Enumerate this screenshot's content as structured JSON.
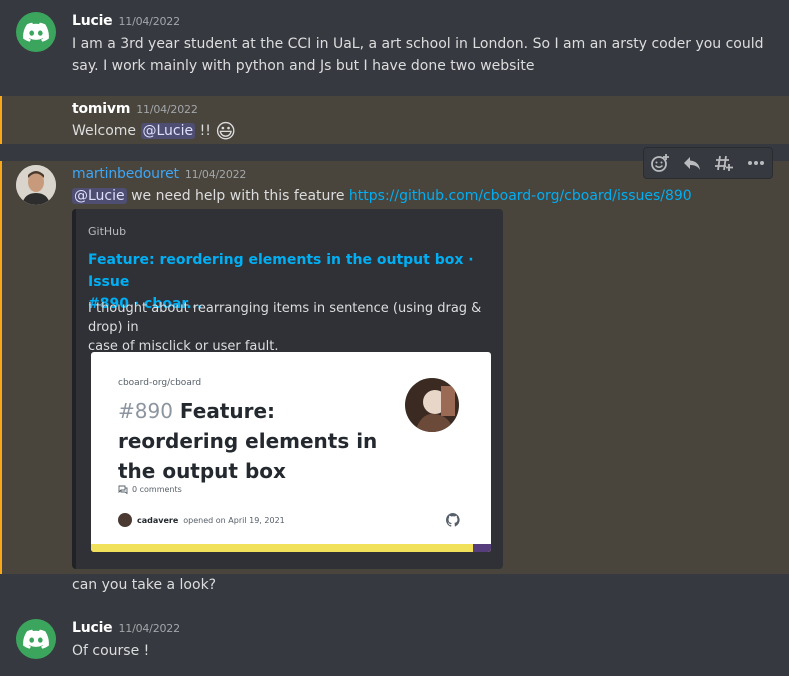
{
  "messages": {
    "m1": {
      "username": "Lucie",
      "timestamp": "11/04/2022",
      "text_line1": "I am a 3rd year student at the CCI in UaL, a art school in London. So I am an arsty coder you could",
      "text_line2": "say. I work mainly with python and Js but I have done two website"
    },
    "m2": {
      "username": "tomivm",
      "timestamp": "11/04/2022",
      "text_before": "Welcome ",
      "mention": "@Lucie",
      "text_after": " !! ",
      "emoji": "😃"
    },
    "m3": {
      "username": "martinbedouret",
      "timestamp": "11/04/2022",
      "mention": "@Lucie",
      "text": " we need help with this feature ",
      "link": "https://github.com/cboard-org/cboard/issues/890",
      "followup": "can you take a look?"
    },
    "m4": {
      "username": "Lucie",
      "timestamp": "11/04/2022",
      "text": "Of course !"
    }
  },
  "embed": {
    "provider": "GitHub",
    "title_line1": "Feature: reordering elements in the output box · Issue",
    "title_line2": "#890 · cboar...",
    "description_line1": "I thought about rearranging items in sentence (using drag & drop) in",
    "description_line2": "case of misclick or user fault.",
    "card": {
      "repo": "cboard-org/cboard",
      "issue_number": "#890",
      "title_line1": " Feature:",
      "title_line2": "reordering elements in",
      "title_line3": "the output box",
      "comments": "0 comments",
      "author": "cadavere",
      "opened": "opened on April 19, 2021"
    }
  },
  "toolbar": {
    "icons": [
      "add-reaction-icon",
      "reply-icon",
      "create-thread-icon",
      "more-icon"
    ]
  },
  "colors": {
    "background": "#36393f",
    "highlight": "#49443c",
    "highlight_bar": "#faa81a",
    "link": "#00aff4",
    "discord_green": "#3ba55d"
  }
}
